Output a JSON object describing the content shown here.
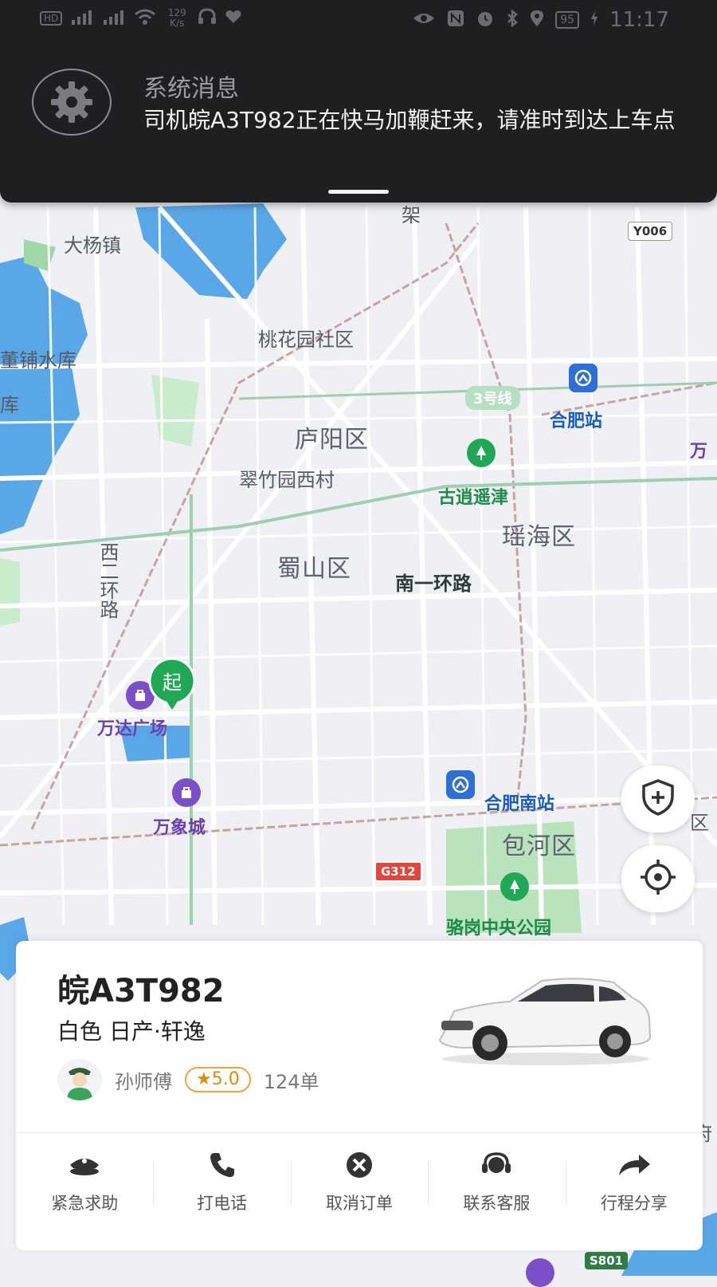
{
  "status_bar": {
    "left_indicators": [
      "HD",
      "4G",
      "4G",
      "wifi",
      "129 K/s",
      "headset-icon",
      "heart-icon"
    ],
    "net_speed": "129\nK/s",
    "battery": "95",
    "time": "11:17"
  },
  "notification": {
    "icon": "gear-icon",
    "title": "系统消息",
    "body": "司机皖A3T982正在快马加鞭赶来，请准时到达上车点"
  },
  "map": {
    "labels": {
      "dayangzhen": "大杨镇",
      "dongpu": "董铺水库",
      "ku": "库",
      "jia": "架",
      "taohuayuan": "桃花园社区",
      "luyang": "庐阳区",
      "cuizhuyuan": "翠竹园西村",
      "shushan": "蜀山区",
      "yaohai": "瑶海区",
      "nanyihuan": "南一环路",
      "xierhuan": "西二环路",
      "gudao": "古逍遥津",
      "hefei_station": "合肥站",
      "hefei_south": "合肥南站",
      "wanda": "万达广场",
      "wanxiang": "万象城",
      "baohe": "包河区",
      "luogang": "骆岗中央公园",
      "wan_edge": "万",
      "qu_edge": "区",
      "fu_edge": "府"
    },
    "badges": {
      "y006": "Y006",
      "line3": "3号线",
      "g312": "G312",
      "s801": "S801"
    },
    "start_marker": "起"
  },
  "floating_buttons": {
    "safety": "shield-plus-icon",
    "locate": "locate-icon"
  },
  "driver_card": {
    "plate": "皖A3T982",
    "car_description": "白色 日产·轩逸",
    "driver_name": "孙师傅",
    "rating": "★5.0",
    "orders": "124单",
    "actions": [
      {
        "label": "紧急求助",
        "icon": "police-cap-icon"
      },
      {
        "label": "打电话",
        "icon": "phone-icon"
      },
      {
        "label": "取消订单",
        "icon": "cancel-icon"
      },
      {
        "label": "联系客服",
        "icon": "headset-icon"
      },
      {
        "label": "行程分享",
        "icon": "share-arrow-icon"
      }
    ]
  },
  "colors": {
    "accent_green": "#1fa855",
    "rating_orange": "#f2a33a",
    "notification_bg": "#1e1f21"
  }
}
